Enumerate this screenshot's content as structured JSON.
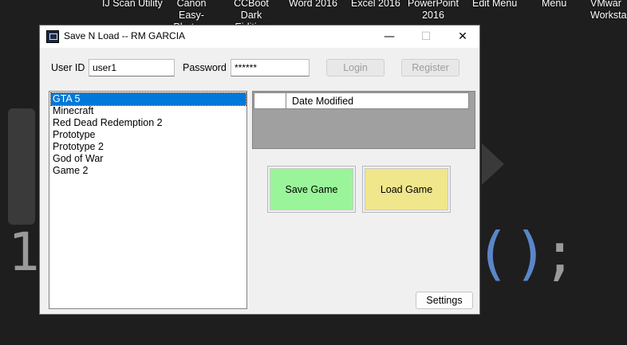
{
  "desktop": {
    "icons": [
      {
        "label": "IJ Scan Utility"
      },
      {
        "label": "Canon\nEasy-Photo…"
      },
      {
        "label": "CCBoot Dark\nEidition"
      },
      {
        "label": "Word 2016"
      },
      {
        "label": "Excel 2016"
      },
      {
        "label": "PowerPoint\n2016"
      },
      {
        "label": "Edit Menu"
      },
      {
        "label": "Menu"
      },
      {
        "label": "VMwar\nWorkstat"
      }
    ],
    "background": {
      "code_digit": "1",
      "code_parens": "()",
      "code_semicolon": ";"
    }
  },
  "window": {
    "title": "Save N Load -- RM GARCIA",
    "controls": {
      "minimize": "—",
      "maximize": "☐",
      "close": "✕"
    }
  },
  "login": {
    "user_label": "User ID",
    "user_value": "user1",
    "password_label": "Password",
    "password_value": "******",
    "login_button": "Login",
    "register_button": "Register"
  },
  "games": {
    "items": [
      "GTA 5",
      "Minecraft",
      "Red Dead Redemption 2",
      "Prototype",
      "Prototype 2",
      "God of War",
      "Game 2"
    ],
    "selected": "GTA 5"
  },
  "saves_grid": {
    "columns": [
      "Date Modified"
    ]
  },
  "actions": {
    "save_label": "Save Game",
    "load_label": "Load Game",
    "save_color": "#9af59a",
    "load_color": "#f0e68c",
    "settings_label": "Settings"
  }
}
